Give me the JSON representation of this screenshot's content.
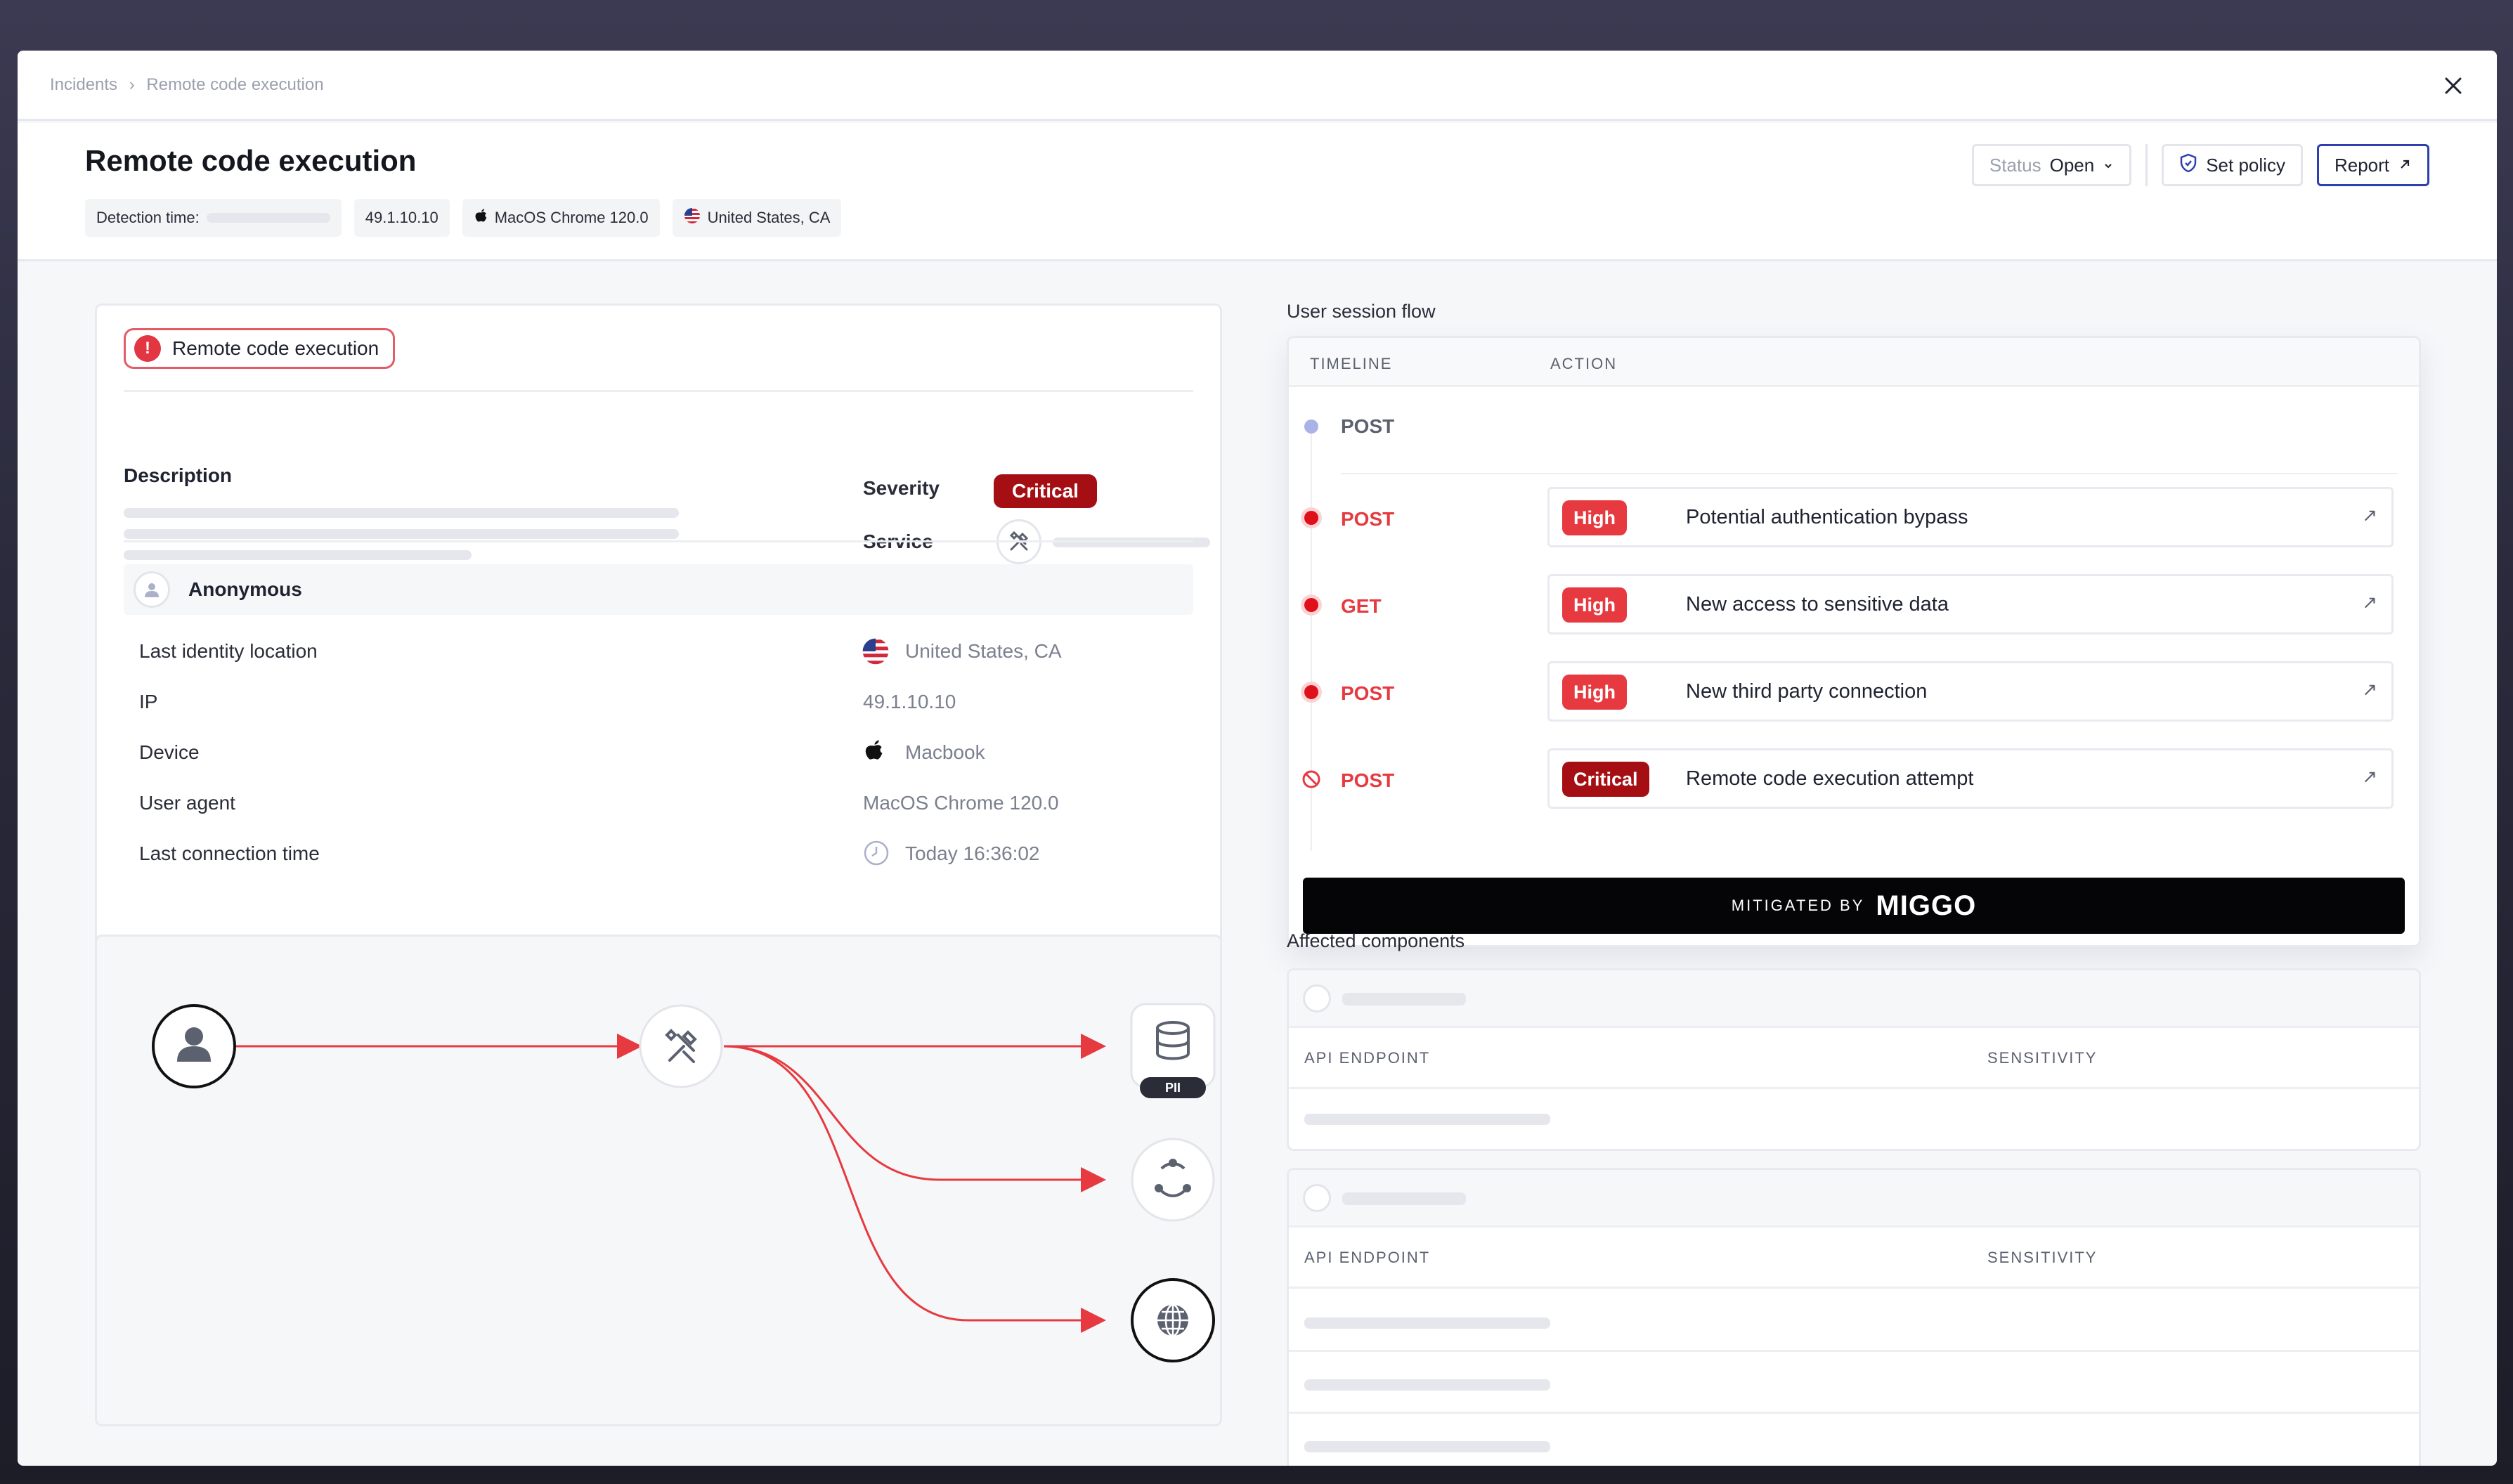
{
  "breadcrumb": {
    "root": "Incidents",
    "separator": "›",
    "current": "Remote code execution"
  },
  "header": {
    "title": "Remote code execution",
    "meta": {
      "detection_label": "Detection time:",
      "ip": "49.1.10.10",
      "device": "MacOS Chrome 120.0",
      "location": "United States, CA"
    },
    "status_label": "Status",
    "status_value": "Open",
    "set_policy": "Set policy",
    "report": "Report"
  },
  "incident": {
    "tag": "Remote code execution",
    "description_label": "Description",
    "severity_label": "Severity",
    "severity_value": "Critical",
    "service_label": "Service",
    "identity": {
      "name": "Anonymous",
      "rows": [
        {
          "label": "Last identity location",
          "value": "United States, CA"
        },
        {
          "label": "IP",
          "value": "49.1.10.10"
        },
        {
          "label": "Device",
          "value": "Macbook"
        },
        {
          "label": "User agent",
          "value": "MacOS Chrome 120.0"
        },
        {
          "label": "Last connection time",
          "value": "Today 16:36:02"
        }
      ]
    }
  },
  "graph": {
    "pii_label": "PII"
  },
  "session_flow": {
    "title": "User session flow",
    "col_timeline": "TIMELINE",
    "col_action": "ACTION",
    "rows": [
      {
        "method": "POST",
        "severity": "",
        "action": ""
      },
      {
        "method": "POST",
        "severity": "High",
        "action": "Potential authentication bypass"
      },
      {
        "method": "GET",
        "severity": "High",
        "action": "New access to sensitive data"
      },
      {
        "method": "POST",
        "severity": "High",
        "action": "New third party connection"
      },
      {
        "method": "POST",
        "severity": "Critical",
        "action": "Remote code execution attempt"
      }
    ],
    "mitigated_label": "MITIGATED BY",
    "mitigated_brand": "MIGGO",
    "colors": {
      "high": "#e63a40",
      "critical": "#a50f14",
      "neutral": "#a9b3e8"
    }
  },
  "affected": {
    "title": "Affected components",
    "col_endpoint": "API ENDPOINT",
    "col_sensitivity": "SENSITIVITY"
  }
}
